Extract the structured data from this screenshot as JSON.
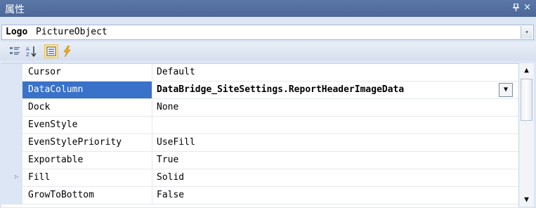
{
  "window": {
    "title": "属性",
    "pin_glyph": "ᚹ",
    "close_glyph": "×"
  },
  "object_selector": {
    "name": "Logo",
    "type": "PictureObject",
    "drop_glyph": "▾"
  },
  "toolbar": {
    "buttons": [
      {
        "name": "categorized-icon"
      },
      {
        "name": "alphabetical-icon"
      },
      {
        "name": "properties-icon",
        "active": true
      },
      {
        "name": "events-icon"
      }
    ]
  },
  "properties": [
    {
      "name": "Cursor",
      "value": "Default"
    },
    {
      "name": "DataColumn",
      "value": "DataBridge_SiteSettings.ReportHeaderImageData",
      "selected": true
    },
    {
      "name": "Dock",
      "value": "None"
    },
    {
      "name": "EvenStyle",
      "value": ""
    },
    {
      "name": "EvenStylePriority",
      "value": "UseFill"
    },
    {
      "name": "Exportable",
      "value": "True"
    },
    {
      "name": "Fill",
      "value": "Solid",
      "expandable": true
    },
    {
      "name": "GrowToBottom",
      "value": "False"
    }
  ],
  "value_dropdown_glyph": "▼",
  "scrollbar": {
    "up_glyph": "▲",
    "down_glyph": "▼"
  },
  "colors": {
    "title_bg": "#4d6898",
    "selection": "#3a71c9",
    "panel_bg": "#dce6f4"
  }
}
